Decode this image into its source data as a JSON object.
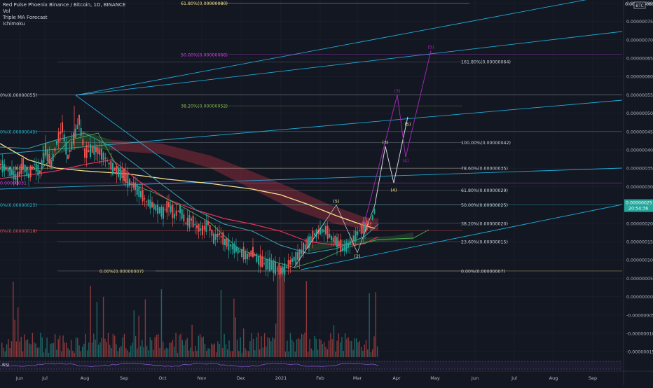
{
  "header": {
    "title": "Red Pulse Phoenix Binance / Bitcoin, 1D, BINANCE",
    "indicators": [
      "Vol",
      "Triple MA Forecast",
      "Ichimoku"
    ]
  },
  "price_axis": {
    "currency": "BTC",
    "top_label": "0.000000080",
    "current_price": "0.00000025",
    "countdown": "20:54:36"
  },
  "rsi_label": "RSI",
  "colors": {
    "background": "#131722",
    "grid": "#1e222d",
    "up": "#26a69a",
    "down": "#ef5350",
    "ma_yellow": "#f5e28a",
    "ma_red": "#e0315a",
    "ma_teal": "#3aa2b5",
    "ichi_green": "#4caf50",
    "channel": "#22a8d4",
    "projection": "#9c27b0",
    "cloud_red": "#8a2c3a",
    "cloud_green": "#2e5a2e",
    "rsi": "#7e57c2"
  },
  "chart_data": {
    "type": "line",
    "title": "Red Pulse Phoenix Binance / Bitcoin, 1D, BINANCE",
    "x_ticks": [
      "Jun",
      "Jul",
      "Aug",
      "Sep",
      "Oct",
      "Nov",
      "Dec",
      "2021",
      "Feb",
      "Mar",
      "Apr",
      "May",
      "Jun",
      "Jul",
      "Aug",
      "Sep"
    ],
    "y_ticks": [
      "0.00000080",
      "0.00000075",
      "0.00000070",
      "0.00000065",
      "0.00000060",
      "0.00000055",
      "0.00000050",
      "0.00000045",
      "0.00000040",
      "0.00000035",
      "0.00000030",
      "0.00000025",
      "0.00000020",
      "0.00000015",
      "0.00000010",
      "0.00000005",
      "0.00000000",
      "-0.00000005",
      "-0.00000010",
      "-0.00000015"
    ],
    "ylim": [
      -1.5e-07,
      8e-07
    ],
    "price_series": {
      "name": "Price",
      "x": [
        0,
        8,
        16,
        24,
        32,
        40,
        48,
        56,
        64,
        72,
        80,
        88,
        96,
        104,
        112,
        120,
        128,
        136,
        144,
        152,
        160,
        168,
        176,
        184,
        192,
        200,
        208,
        216,
        224,
        232,
        240,
        248,
        256,
        264,
        272,
        280,
        288,
        296,
        304,
        312,
        320,
        328,
        336,
        344,
        352,
        360,
        368,
        376,
        384,
        392,
        400,
        408,
        416,
        424,
        432,
        440,
        448,
        456,
        464,
        472,
        480,
        488,
        496,
        504,
        512,
        520,
        528,
        536
      ],
      "y": [
        3.6e-07,
        3.5e-07,
        3.4e-07,
        3.2e-07,
        3.6e-07,
        3.3e-07,
        3.6e-07,
        3.4e-07,
        4e-07,
        3.6e-07,
        4.2e-07,
        4.6e-07,
        3.8e-07,
        4.3e-07,
        4.8e-07,
        3.9e-07,
        4e-07,
        4e-07,
        3.9e-07,
        3.7e-07,
        3.5e-07,
        3.4e-07,
        3.3e-07,
        3.1e-07,
        3e-07,
        2.8e-07,
        2.6e-07,
        2.5e-07,
        2.4e-07,
        2.3e-07,
        2.5e-07,
        2.2e-07,
        2.4e-07,
        2e-07,
        2.1e-07,
        1.9e-07,
        1.8e-07,
        2e-07,
        1.6e-07,
        1.7e-07,
        1.5e-07,
        1.4e-07,
        1.3e-07,
        1.2e-07,
        1.1e-07,
        1.2e-07,
        1e-07,
        9e-08,
        9e-08,
        8e-08,
        7e-08,
        8e-08,
        1e-07,
        1.1e-07,
        1.3e-07,
        1.5e-07,
        1.7e-07,
        1.8e-07,
        1.8e-07,
        1.6e-07,
        1.5e-07,
        1.3e-07,
        1.4e-07,
        1.6e-07,
        1.8e-07,
        1.9e-07,
        2e-07,
        2.5e-07
      ]
    },
    "annotations": {
      "fib_left": [
        {
          "label": "61.80%(0.00000080)",
          "price": 8e-07,
          "color": "#f5e28a"
        },
        {
          "label": "50.00%(0.00000066)",
          "price": 6.6e-07,
          "color": "#e040fb"
        },
        {
          "label": "0%(0.00000055)",
          "price": 5.5e-07,
          "color": "#d1d4dc"
        },
        {
          "label": "38.20%(0.00000052)",
          "price": 5.2e-07,
          "color": "#8bc34a"
        },
        {
          "label": "0%(0.00000045)",
          "price": 4.5e-07,
          "color": "#26c6da"
        },
        {
          "label": "0%(0.00000035)",
          "price": 3.5e-07,
          "color": "#f5e28a"
        },
        {
          "label": "0.00000031",
          "price": 3.1e-07,
          "color": "#e040fb"
        },
        {
          "label": "0%(0.00000025)",
          "price": 2.5e-07,
          "color": "#26c6da"
        },
        {
          "label": "0%(0.00000018)",
          "price": 1.8e-07,
          "color": "#ef5350"
        },
        {
          "label": "0.00%(0.00000007)",
          "price": 7e-08,
          "color": "#f5e28a"
        }
      ],
      "fib_right": [
        {
          "label": "161.80%(0.00000064)",
          "price": 6.4e-07
        },
        {
          "label": "100.00%(0.00000042)",
          "price": 4.2e-07
        },
        {
          "label": "78.60%(0.00000035)",
          "price": 3.5e-07
        },
        {
          "label": "61.80%(0.00000029)",
          "price": 2.9e-07
        },
        {
          "label": "50.00%(0.00000025)",
          "price": 2.5e-07
        },
        {
          "label": "38.20%(0.00000020)",
          "price": 2e-07
        },
        {
          "label": "23.60%(0.00000015)",
          "price": 1.5e-07
        },
        {
          "label": "0.00%(0.00000007)",
          "price": 7e-08
        }
      ],
      "waves": [
        {
          "label": "(5)",
          "x": 480,
          "price": 2.6e-07,
          "color": "#f5e28a"
        },
        {
          "label": "(2)",
          "x": 510,
          "price": 1.1e-07,
          "color": "#f5e28a"
        },
        {
          "label": "(3)",
          "x": 550,
          "price": 4.2e-07,
          "color": "#f5e28a"
        },
        {
          "label": "(4)",
          "x": 562,
          "price": 2.9e-07,
          "color": "#f5e28a"
        },
        {
          "label": "(5)",
          "x": 582,
          "price": 4.7e-07,
          "color": "#f5e28a"
        },
        {
          "label": "(3)",
          "x": 567,
          "price": 5.6e-07,
          "color": "#9c27b0"
        },
        {
          "label": "(4)",
          "x": 579,
          "price": 3.7e-07,
          "color": "#9c27b0"
        },
        {
          "label": "(5)",
          "x": 615,
          "price": 6.8e-07,
          "color": "#9c27b0"
        }
      ]
    }
  }
}
